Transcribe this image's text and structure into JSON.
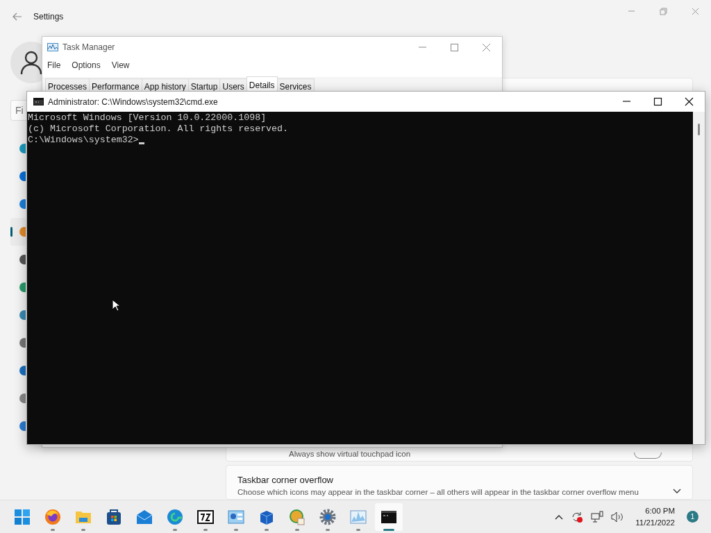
{
  "settings": {
    "title": "Settings",
    "search": {
      "placeholder": "Fi"
    },
    "nav": [
      {
        "selected": false
      },
      {
        "selected": false
      },
      {
        "selected": false
      },
      {
        "selected": true
      },
      {
        "selected": false
      },
      {
        "selected": false
      },
      {
        "selected": false
      },
      {
        "selected": false
      },
      {
        "selected": false
      },
      {
        "selected": false
      },
      {
        "selected": false
      }
    ],
    "cards": [
      {
        "kind": "toggle",
        "label": "Always show virtual touchpad icon",
        "on": false
      },
      {
        "kind": "expander",
        "title": "Taskbar corner overflow",
        "description": "Choose which icons may appear in the taskbar corner – all others will appear in the taskbar corner overflow menu",
        "expanded": false
      }
    ]
  },
  "task_manager": {
    "title": "Task Manager",
    "menu": [
      "File",
      "Options",
      "View"
    ],
    "tabs": [
      {
        "label": "Processes",
        "selected": false
      },
      {
        "label": "Performance",
        "selected": false
      },
      {
        "label": "App history",
        "selected": false
      },
      {
        "label": "Startup",
        "selected": false
      },
      {
        "label": "Users",
        "selected": false
      },
      {
        "label": "Details",
        "selected": true
      },
      {
        "label": "Services",
        "selected": false
      }
    ]
  },
  "cmd": {
    "title": "Administrator: C:\\Windows\\system32\\cmd.exe",
    "lines": [
      "Microsoft Windows [Version 10.0.22000.1098]",
      "(c) Microsoft Corporation. All rights reserved.",
      "C:\\Windows\\system32>"
    ]
  },
  "taskbar": {
    "apps": [
      {
        "kind": "windows",
        "running": false,
        "selected": false
      },
      {
        "kind": "fox",
        "running": true,
        "selected": false
      },
      {
        "kind": "folder",
        "running": true,
        "selected": false
      },
      {
        "kind": "bag",
        "running": false,
        "selected": false
      },
      {
        "kind": "mail",
        "running": false,
        "selected": false
      },
      {
        "kind": "wave",
        "running": true,
        "selected": false
      },
      {
        "kind": "archive",
        "running": true,
        "selected": false
      },
      {
        "kind": "panel",
        "running": true,
        "selected": false
      },
      {
        "kind": "box",
        "running": true,
        "selected": false
      },
      {
        "kind": "globe",
        "running": true,
        "selected": false
      },
      {
        "kind": "gear",
        "running": true,
        "selected": false
      },
      {
        "kind": "chart",
        "running": true,
        "selected": false
      },
      {
        "kind": "console",
        "running": true,
        "selected": true
      }
    ],
    "tray": {
      "time": "6:00 PM",
      "date": "11/21/2022",
      "notifications": "1"
    }
  }
}
